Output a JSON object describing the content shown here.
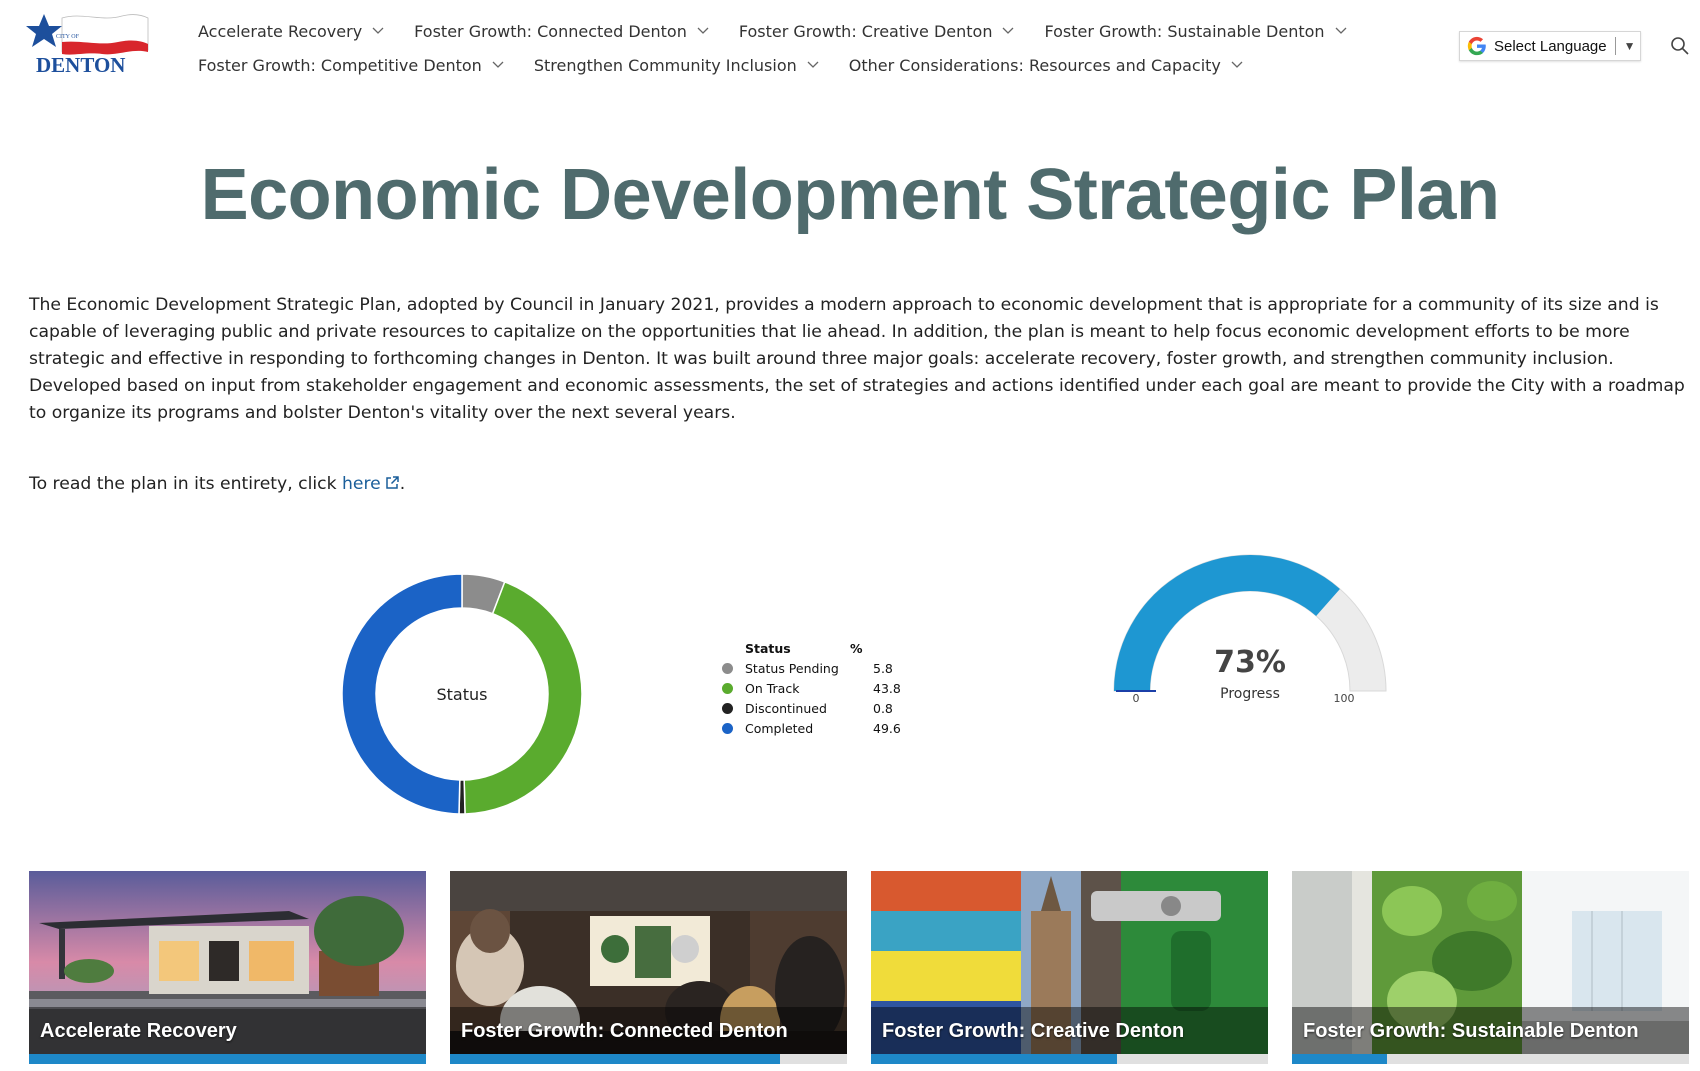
{
  "header": {
    "logo_text_city": "CITY OF",
    "logo_text_name": "DENTON",
    "nav_rows": [
      [
        "Accelerate Recovery",
        "Foster Growth: Connected Denton",
        "Foster Growth: Creative Denton",
        "Foster Growth: Sustainable Denton"
      ],
      [
        "Foster Growth: Competitive Denton",
        "Strengthen Community Inclusion",
        "Other Considerations: Resources and Capacity"
      ]
    ],
    "language_label": "Select Language"
  },
  "page": {
    "title": "Economic Development Strategic Plan",
    "intro": "The Economic Development Strategic Plan, adopted by Council in January 2021, provides a modern approach to economic development that is appropriate for a community of its size and is capable of leveraging public and private resources to capitalize on the opportunities that lie ahead. In addition, the plan is meant to help focus economic development efforts to be more strategic and effective in responding to forthcoming changes in Denton. It was built around three major goals: accelerate recovery, foster growth, and strengthen community inclusion. Developed based on input from stakeholder engagement and economic assessments, the set of strategies and actions identified under each goal are meant to provide the City with a roadmap to organize its programs and bolster Denton's vitality over the next several years.",
    "read_prefix": "To read the plan in its entirety, click ",
    "read_link": "here",
    "read_suffix": "."
  },
  "chart_data": [
    {
      "type": "pie",
      "title": "Status",
      "legend_header": [
        "Status",
        "%"
      ],
      "categories": [
        "Status Pending",
        "On Track",
        "Discontinued",
        "Completed"
      ],
      "values": [
        5.8,
        43.8,
        0.8,
        49.6
      ],
      "colors": [
        "#8c8c8c",
        "#5aab2e",
        "#222222",
        "#1b63c6"
      ],
      "legend": "right"
    },
    {
      "type": "gauge",
      "value": 73,
      "value_label": "73%",
      "label": "Progress",
      "min": 0,
      "max": 100,
      "color": "#1e97d2",
      "track_color": "#ececec"
    }
  ],
  "cards": [
    {
      "title": "Accelerate Recovery",
      "progress": 1.0
    },
    {
      "title": "Foster Growth: Connected Denton",
      "progress": 0.83
    },
    {
      "title": "Foster Growth: Creative Denton",
      "progress": 0.62
    },
    {
      "title": "Foster Growth: Sustainable Denton",
      "progress": 0.24
    }
  ],
  "colors": {
    "title": "#4f6b6d",
    "link": "#1a5e9a",
    "progress_fill": "#1e88c8"
  }
}
